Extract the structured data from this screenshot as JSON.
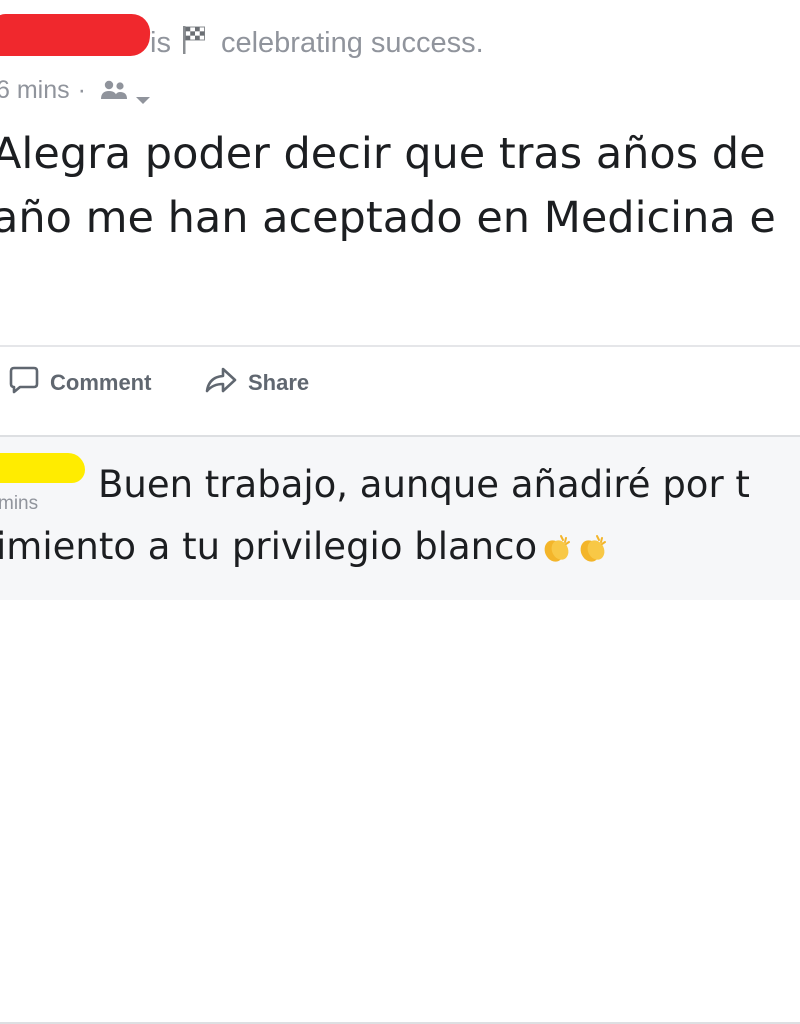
{
  "post": {
    "header_verb": "is",
    "activity": "celebrating success.",
    "time": "6 mins",
    "separator": "·",
    "audience_icon": "friends-icon",
    "body_lines": [
      "Alegra poder decir que tras años de",
      "año me han aceptado en Medicina e"
    ]
  },
  "actions": {
    "comment_label": "Comment",
    "share_label": "Share"
  },
  "comment": {
    "time": "mins",
    "line1": "Buen trabajo, aunque añadiré por t",
    "line2": "imiento a tu privilegio blanco",
    "emojis": [
      "clapping-hands-icon",
      "clapping-hands-icon"
    ]
  },
  "colors": {
    "redaction_red": "#f0282d",
    "redaction_yellow": "#ffec00",
    "meta_gray": "#90949c",
    "text": "#1c1e21"
  }
}
